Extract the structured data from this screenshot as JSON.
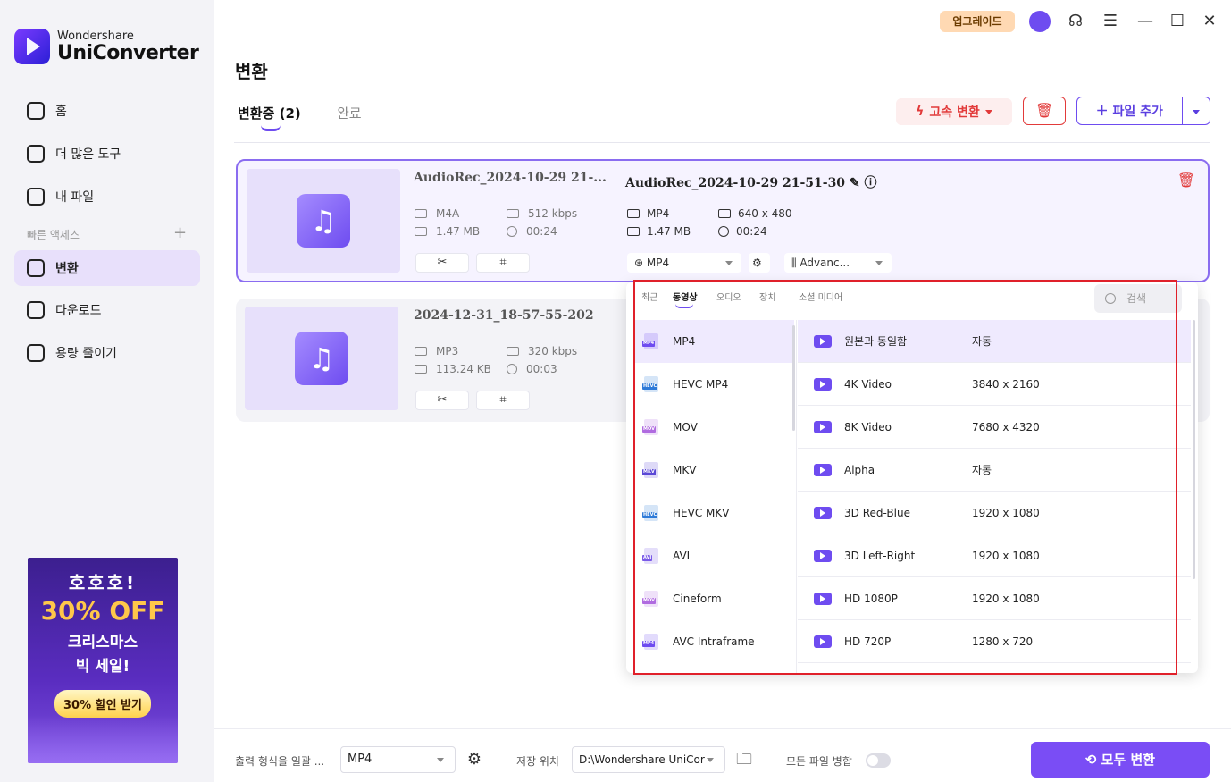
{
  "brand": {
    "line1": "Wondershare",
    "line2": "UniConverter"
  },
  "sidebar": {
    "items": [
      {
        "label": "홈"
      },
      {
        "label": "더 많은 도구"
      },
      {
        "label": "내 파일"
      }
    ],
    "quick_access": "빠른 액세스",
    "quick_items": [
      {
        "label": "변환"
      },
      {
        "label": "다운로드"
      },
      {
        "label": "용량 줄이기"
      }
    ],
    "promo": {
      "line1": "호호호!",
      "line2": "30% OFF",
      "line3": "크리스마스",
      "line4": "빅 세일!",
      "button": "30% 할인 받기"
    }
  },
  "topbar": {
    "upgrade": "업그레이드"
  },
  "page": {
    "title": "변환",
    "tabs": [
      {
        "label": "변환중 (2)"
      },
      {
        "label": "완료"
      }
    ],
    "fast_convert": "고속 변환",
    "add_file": "파일 추가"
  },
  "files": [
    {
      "name": "AudioRec_2024-10-29 21-...",
      "format": "M4A",
      "bitrate": "512 kbps",
      "size": "1.47 MB",
      "duration": "00:24",
      "output": {
        "name": "AudioRec_2024-10-29 21-51-30",
        "format": "MP4",
        "resolution": "640 x 480",
        "size": "1.47 MB",
        "duration": "00:24",
        "format_select": "MP4",
        "audio_select": "Advanc..."
      }
    },
    {
      "name": "2024-12-31_18-57-55-202",
      "format": "MP3",
      "bitrate": "320 kbps",
      "size": "113.24 KB",
      "duration": "00:03"
    }
  ],
  "format_panel": {
    "tabs": [
      "최근",
      "동영상",
      "오디오",
      "장치",
      "소셜 미디어"
    ],
    "search_placeholder": "검색",
    "formats": [
      {
        "label": "MP4",
        "tag": "MP4",
        "color": "#6e4cf0"
      },
      {
        "label": "HEVC MP4",
        "tag": "HEVC",
        "color": "#2f7bd8"
      },
      {
        "label": "MOV",
        "tag": "MOV",
        "color": "#b06be0"
      },
      {
        "label": "MKV",
        "tag": "MKV",
        "color": "#5a48d6"
      },
      {
        "label": "HEVC MKV",
        "tag": "HEVC",
        "color": "#2f7bd8"
      },
      {
        "label": "AVI",
        "tag": "AVI",
        "color": "#7a5ae8"
      },
      {
        "label": "Cineform",
        "tag": "MOV",
        "color": "#b06be0"
      },
      {
        "label": "AVC Intraframe",
        "tag": "MP4",
        "color": "#6e4cf0"
      }
    ],
    "presets": [
      {
        "name": "원본과 동일함",
        "res": "자동"
      },
      {
        "name": "4K Video",
        "res": "3840 x 2160"
      },
      {
        "name": "8K Video",
        "res": "7680 x 4320"
      },
      {
        "name": "Alpha",
        "res": "자동"
      },
      {
        "name": "3D Red-Blue",
        "res": "1920 x 1080"
      },
      {
        "name": "3D Left-Right",
        "res": "1920 x 1080"
      },
      {
        "name": "HD 1080P",
        "res": "1920 x 1080"
      },
      {
        "name": "HD 720P",
        "res": "1280 x 720"
      }
    ]
  },
  "bottom": {
    "output_format_label": "출력 형식을 일괄 ...",
    "output_format_value": "MP4",
    "save_label": "저장 위치",
    "save_path": "D:\\Wondershare UniCor",
    "merge_label": "모든 파일 병합",
    "convert_all": "모두 변환"
  }
}
